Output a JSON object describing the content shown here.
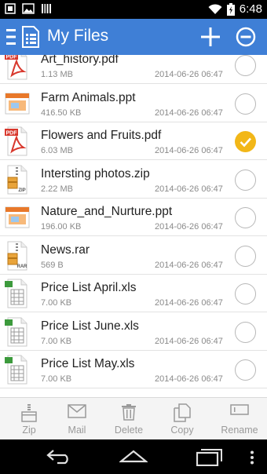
{
  "status": {
    "time": "6:48"
  },
  "header": {
    "title": "My Files"
  },
  "files": [
    {
      "name": "Art_history.pdf",
      "size": "1.13 MB",
      "date": "2014-06-26 06:47",
      "type": "pdf",
      "type_label": "PDF",
      "checked": false
    },
    {
      "name": "Farm Animals.ppt",
      "size": "416.50 KB",
      "date": "2014-06-26 06:47",
      "type": "ppt",
      "type_label": "",
      "checked": false
    },
    {
      "name": "Flowers and Fruits.pdf",
      "size": "6.03 MB",
      "date": "2014-06-26 06:47",
      "type": "pdf",
      "type_label": "PDF",
      "checked": true
    },
    {
      "name": "Intersting photos.zip",
      "size": "2.22 MB",
      "date": "2014-06-26 06:47",
      "type": "zip",
      "type_label": "ZIP",
      "checked": false
    },
    {
      "name": "Nature_and_Nurture.ppt",
      "size": "196.00 KB",
      "date": "2014-06-26 06:47",
      "type": "ppt",
      "type_label": "",
      "checked": false
    },
    {
      "name": "News.rar",
      "size": "569 B",
      "date": "2014-06-26 06:47",
      "type": "rar",
      "type_label": "RAR",
      "checked": false
    },
    {
      "name": "Price List April.xls",
      "size": "7.00 KB",
      "date": "2014-06-26 06:47",
      "type": "xls",
      "type_label": "",
      "checked": false
    },
    {
      "name": "Price List June.xls",
      "size": "7.00 KB",
      "date": "2014-06-26 06:47",
      "type": "xls",
      "type_label": "",
      "checked": false
    },
    {
      "name": "Price List May.xls",
      "size": "7.00 KB",
      "date": "2014-06-26 06:47",
      "type": "xls",
      "type_label": "",
      "checked": false
    }
  ],
  "toolbar": {
    "zip_label": "Zip",
    "mail_label": "Mail",
    "delete_label": "Delete",
    "copy_label": "Copy",
    "rename_label": "Rename"
  },
  "colors": {
    "header": "#3f7fd6",
    "checked": "#f2b718",
    "pdf": "#d8372c",
    "ppt": "#e8782a",
    "xls": "#3c9a3c"
  }
}
